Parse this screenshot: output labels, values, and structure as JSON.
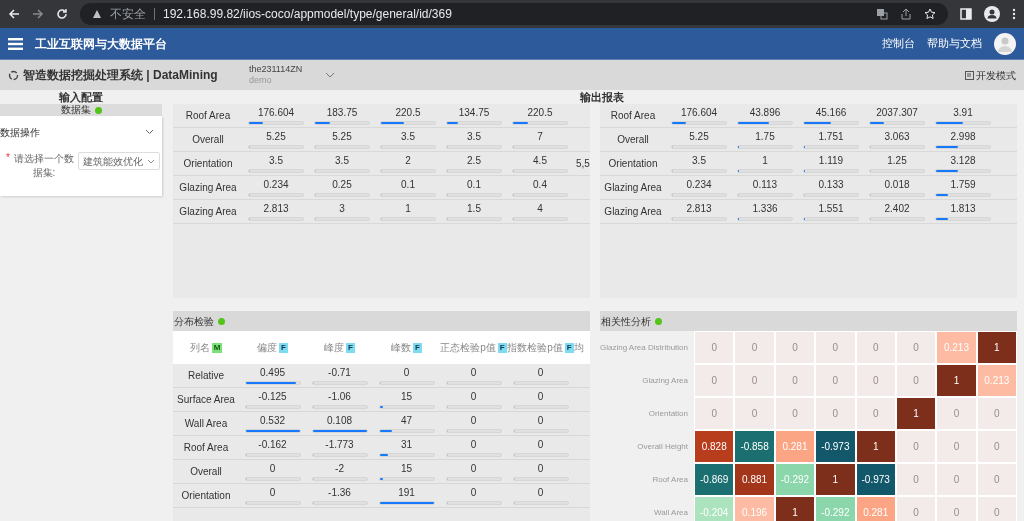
{
  "browser": {
    "security": "不安全",
    "url": "192.168.99.82/iios-coco/appmodel/type/general/id/369"
  },
  "header": {
    "title": "工业互联网与大数据平台",
    "links": [
      "控制台",
      "帮助与文档"
    ]
  },
  "subheader": {
    "title": "智造数据挖掘处理系统 | DataMining",
    "project": "the231114ZN",
    "project_sub": "demo",
    "mode_button": "开发模式"
  },
  "input_config": {
    "title": "输入配置",
    "section": "数据集",
    "operation": "数据操作",
    "field_label": "请选择一个数据集:",
    "field_value": "建筑能效优化",
    "required_mark": "*"
  },
  "output_title": "输出报表",
  "table_left": {
    "rows": [
      {
        "label": "Roof Area",
        "cells": [
          {
            "text": "176.604",
            "level": 0.25
          },
          {
            "text": "183.75",
            "level": 0.27
          },
          {
            "text": "220.5",
            "level": 0.42
          },
          {
            "text": "134.75",
            "level": 0.2
          },
          {
            "text": "220.5",
            "level": 0.28
          }
        ]
      },
      {
        "label": "Overall",
        "cells": [
          {
            "text": "5.25",
            "level": 0
          },
          {
            "text": "5.25",
            "level": 0
          },
          {
            "text": "3.5",
            "level": 0
          },
          {
            "text": "3.5",
            "level": 0
          },
          {
            "text": "7",
            "level": 0
          }
        ]
      },
      {
        "label": "Orientation",
        "cells": [
          {
            "text": "3.5",
            "level": 0
          },
          {
            "text": "3.5",
            "level": 0
          },
          {
            "text": "2",
            "level": 0
          },
          {
            "text": "2.5",
            "level": 0
          },
          {
            "text": "4.5",
            "level": 0
          }
        ],
        "overflow": "5,5"
      },
      {
        "label": "Glazing Area",
        "cells": [
          {
            "text": "0.234",
            "level": 0
          },
          {
            "text": "0.25",
            "level": 0
          },
          {
            "text": "0.1",
            "level": 0
          },
          {
            "text": "0.1",
            "level": 0
          },
          {
            "text": "0.4",
            "level": 0
          }
        ]
      },
      {
        "label": "Glazing Area",
        "cells": [
          {
            "text": "2.813",
            "level": 0
          },
          {
            "text": "3",
            "level": 0
          },
          {
            "text": "1",
            "level": 0
          },
          {
            "text": "1.5",
            "level": 0
          },
          {
            "text": "4",
            "level": 0
          }
        ]
      }
    ]
  },
  "table_right": {
    "rows": [
      {
        "label": "Roof Area",
        "cells": [
          {
            "text": "176.604",
            "level": 0.25
          },
          {
            "text": "43.896",
            "level": 0.58
          },
          {
            "text": "45.166",
            "level": 0.5
          },
          {
            "text": "2037.307",
            "level": 0.25
          },
          {
            "text": "3.91",
            "level": 0.5
          }
        ]
      },
      {
        "label": "Overall",
        "cells": [
          {
            "text": "5.25",
            "level": 0
          },
          {
            "text": "1.75",
            "level": 0.02
          },
          {
            "text": "1.751",
            "level": 0.02
          },
          {
            "text": "3.063",
            "level": 0
          },
          {
            "text": "2.998",
            "level": 0.4
          }
        ]
      },
      {
        "label": "Orientation",
        "cells": [
          {
            "text": "3.5",
            "level": 0
          },
          {
            "text": "1",
            "level": 0.02
          },
          {
            "text": "1.119",
            "level": 0.02
          },
          {
            "text": "1.25",
            "level": 0
          },
          {
            "text": "3.128",
            "level": 0.4
          }
        ]
      },
      {
        "label": "Glazing Area",
        "cells": [
          {
            "text": "0.234",
            "level": 0
          },
          {
            "text": "0.113",
            "level": 0
          },
          {
            "text": "0.133",
            "level": 0
          },
          {
            "text": "0.018",
            "level": 0
          },
          {
            "text": "1.759",
            "level": 0.22
          }
        ]
      },
      {
        "label": "Glazing Area",
        "cells": [
          {
            "text": "2.813",
            "level": 0
          },
          {
            "text": "1.336",
            "level": 0.02
          },
          {
            "text": "1.551",
            "level": 0.02
          },
          {
            "text": "2.402",
            "level": 0
          },
          {
            "text": "1.813",
            "level": 0.22
          }
        ]
      }
    ]
  },
  "distribution": {
    "title": "分布检验",
    "label_column": {
      "label": "列名",
      "badge": "M"
    },
    "columns": [
      {
        "label": "偏度",
        "badge": "F"
      },
      {
        "label": "峰度",
        "badge": "F"
      },
      {
        "label": "峰数",
        "badge": "F"
      },
      {
        "label": "正态检验p值",
        "badge": "F"
      },
      {
        "label": "指数检验p值",
        "badge": "F"
      },
      {
        "label": "均"
      }
    ],
    "rows": [
      {
        "label": "Relative",
        "cells": [
          {
            "text": "0.495",
            "level": 0.93
          },
          {
            "text": "-0.71",
            "level": 0
          },
          {
            "text": "0",
            "level": 0
          },
          {
            "text": "0",
            "level": 0
          },
          {
            "text": "0",
            "level": 0
          }
        ]
      },
      {
        "label": "Surface Area",
        "cells": [
          {
            "text": "-0.125",
            "level": 0
          },
          {
            "text": "-1.06",
            "level": 0
          },
          {
            "text": "15",
            "level": 0.06
          },
          {
            "text": "0",
            "level": 0
          },
          {
            "text": "0",
            "level": 0
          }
        ]
      },
      {
        "label": "Wall Area",
        "cells": [
          {
            "text": "0.532",
            "level": 1
          },
          {
            "text": "0.108",
            "level": 1
          },
          {
            "text": "47",
            "level": 0.24
          },
          {
            "text": "0",
            "level": 0
          },
          {
            "text": "0",
            "level": 0
          }
        ]
      },
      {
        "label": "Roof Area",
        "cells": [
          {
            "text": "-0.162",
            "level": 0
          },
          {
            "text": "-1.773",
            "level": 0
          },
          {
            "text": "31",
            "level": 0.16
          },
          {
            "text": "0",
            "level": 0
          },
          {
            "text": "0",
            "level": 0
          }
        ]
      },
      {
        "label": "Overall",
        "cells": [
          {
            "text": "0",
            "level": 0
          },
          {
            "text": "-2",
            "level": 0
          },
          {
            "text": "15",
            "level": 0.06
          },
          {
            "text": "0",
            "level": 0
          },
          {
            "text": "0",
            "level": 0
          }
        ]
      },
      {
        "label": "Orientation",
        "cells": [
          {
            "text": "0",
            "level": 0
          },
          {
            "text": "-1.36",
            "level": 0
          },
          {
            "text": "191",
            "level": 1
          },
          {
            "text": "0",
            "level": 0
          },
          {
            "text": "0",
            "level": 0
          }
        ]
      }
    ]
  },
  "correlation": {
    "title": "相关性分析",
    "rows": [
      {
        "label": "Glazing Area Distribution",
        "values": [
          "0",
          "0",
          "0",
          "0",
          "0",
          "0",
          "0.213",
          "1"
        ]
      },
      {
        "label": "Glazing Area",
        "values": [
          "0",
          "0",
          "0",
          "0",
          "0",
          "0",
          "1",
          "0.213"
        ]
      },
      {
        "label": "Orientation",
        "values": [
          "0",
          "0",
          "0",
          "0",
          "0",
          "1",
          "0",
          "0"
        ]
      },
      {
        "label": "Overall Height",
        "values": [
          "0.828",
          "-0.858",
          "0.281",
          "-0.973",
          "1",
          "0",
          "0",
          "0"
        ]
      },
      {
        "label": "Roof Area",
        "values": [
          "-0.869",
          "0.881",
          "-0.292",
          "1",
          "-0.973",
          "0",
          "0",
          "0"
        ]
      },
      {
        "label": "Wall Area",
        "values": [
          "-0.204",
          "0.196",
          "1",
          "-0.292",
          "0.281",
          "0",
          "0",
          "0"
        ]
      }
    ]
  }
}
